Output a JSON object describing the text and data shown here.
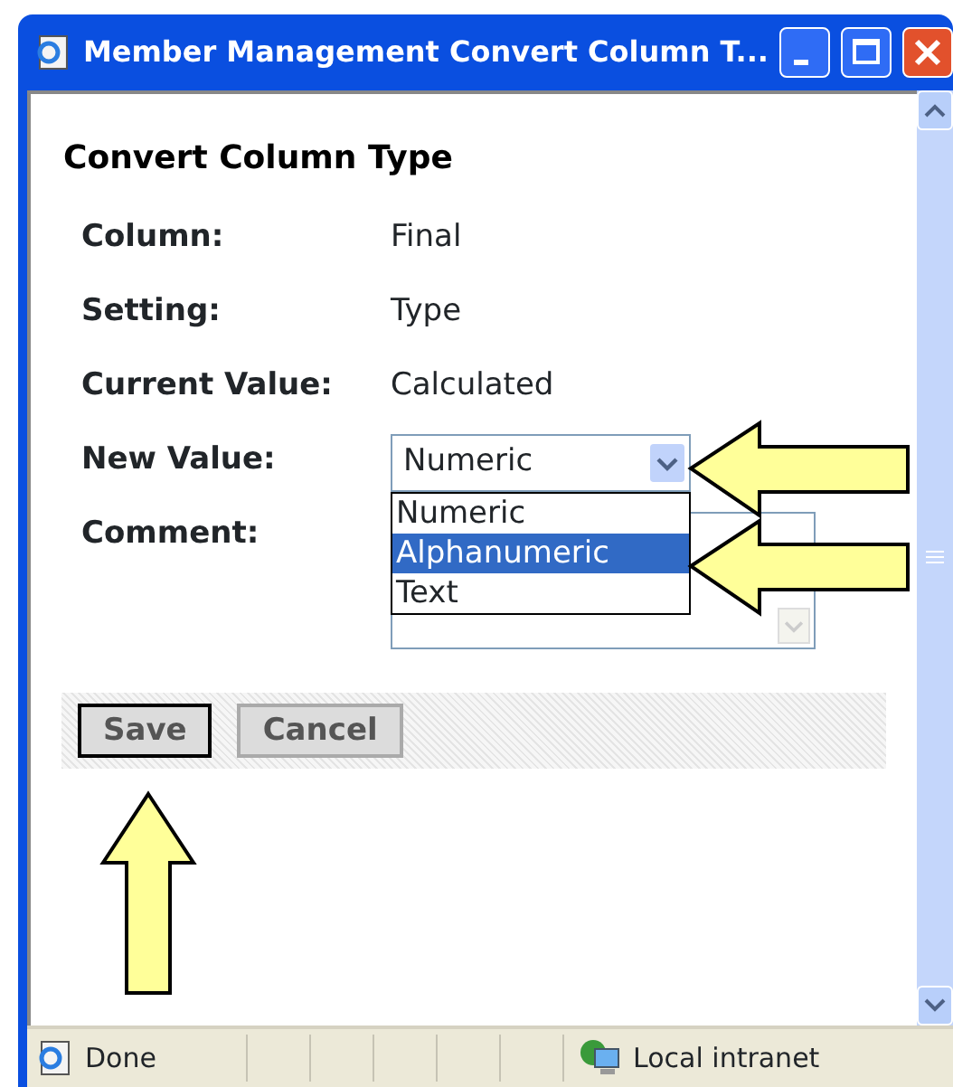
{
  "window": {
    "title": "Member Management Convert Column T..."
  },
  "page": {
    "heading": "Convert Column Type",
    "fields": [
      {
        "label": "Column:",
        "value": "Final"
      },
      {
        "label": "Setting:",
        "value": "Type"
      },
      {
        "label": "Current Value:",
        "value": "Calculated"
      }
    ],
    "new_value": {
      "label": "New Value:",
      "value": "Numeric",
      "expanded": true,
      "options": [
        {
          "label": "Numeric",
          "highlighted": false
        },
        {
          "label": "Alphanumeric",
          "highlighted": true
        },
        {
          "label": "Text",
          "highlighted": false
        }
      ]
    },
    "comment": {
      "label": "Comment:"
    },
    "buttons": [
      {
        "label": "Save",
        "focused": true
      },
      {
        "label": "Cancel",
        "focused": false
      }
    ]
  },
  "status_bar": {
    "status": "Done",
    "zone": "Local intranet"
  }
}
